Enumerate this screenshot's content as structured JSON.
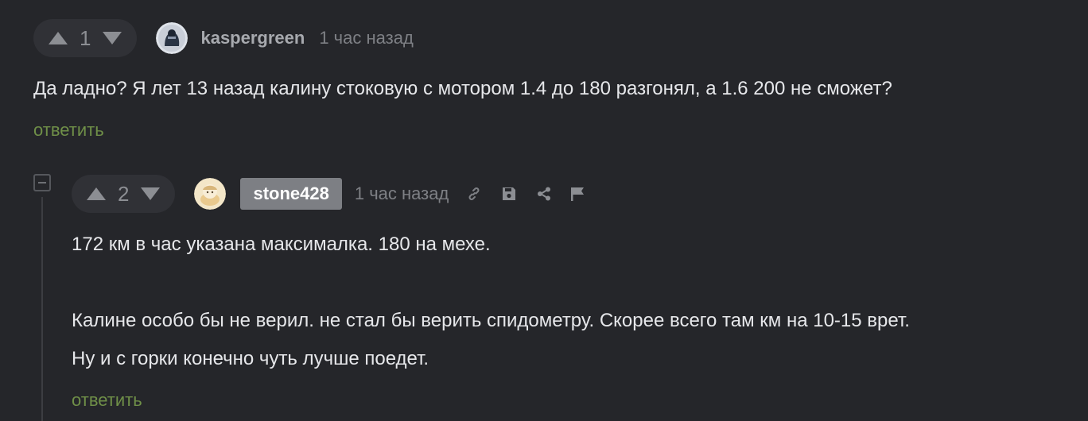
{
  "comments": [
    {
      "rating": "1",
      "username": "kaspergreen",
      "avatar_icon": "avatar-kaspergreen",
      "time": "1 час назад",
      "text_lines": [
        "Да ладно? Я лет 13 назад калину стоковую с мотором 1.4 до 180 разгонял, а 1.6 200 не сможет?"
      ],
      "reply_label": "ответить"
    },
    {
      "rating": "2",
      "username": "stone428",
      "avatar_icon": "avatar-stone428",
      "time": "1 час назад",
      "actions": [
        "link-icon",
        "save-icon",
        "share-icon",
        "flag-icon"
      ],
      "text_lines": [
        "172 км в час указана максималка. 180 на мехе.",
        "",
        "Калине особо бы не верил. не стал бы верить спидометру. Скорее всего там км на 10-15 врет.",
        "Ну и с горки конечно чуть лучше поедет."
      ],
      "reply_label": "ответить"
    }
  ],
  "colors": {
    "background": "#25262a",
    "vote_bg": "#303136",
    "text": "#e6e7ea",
    "muted": "#7e8085",
    "reply_green": "#6f8f48",
    "badge_bg": "#7d7f84"
  }
}
